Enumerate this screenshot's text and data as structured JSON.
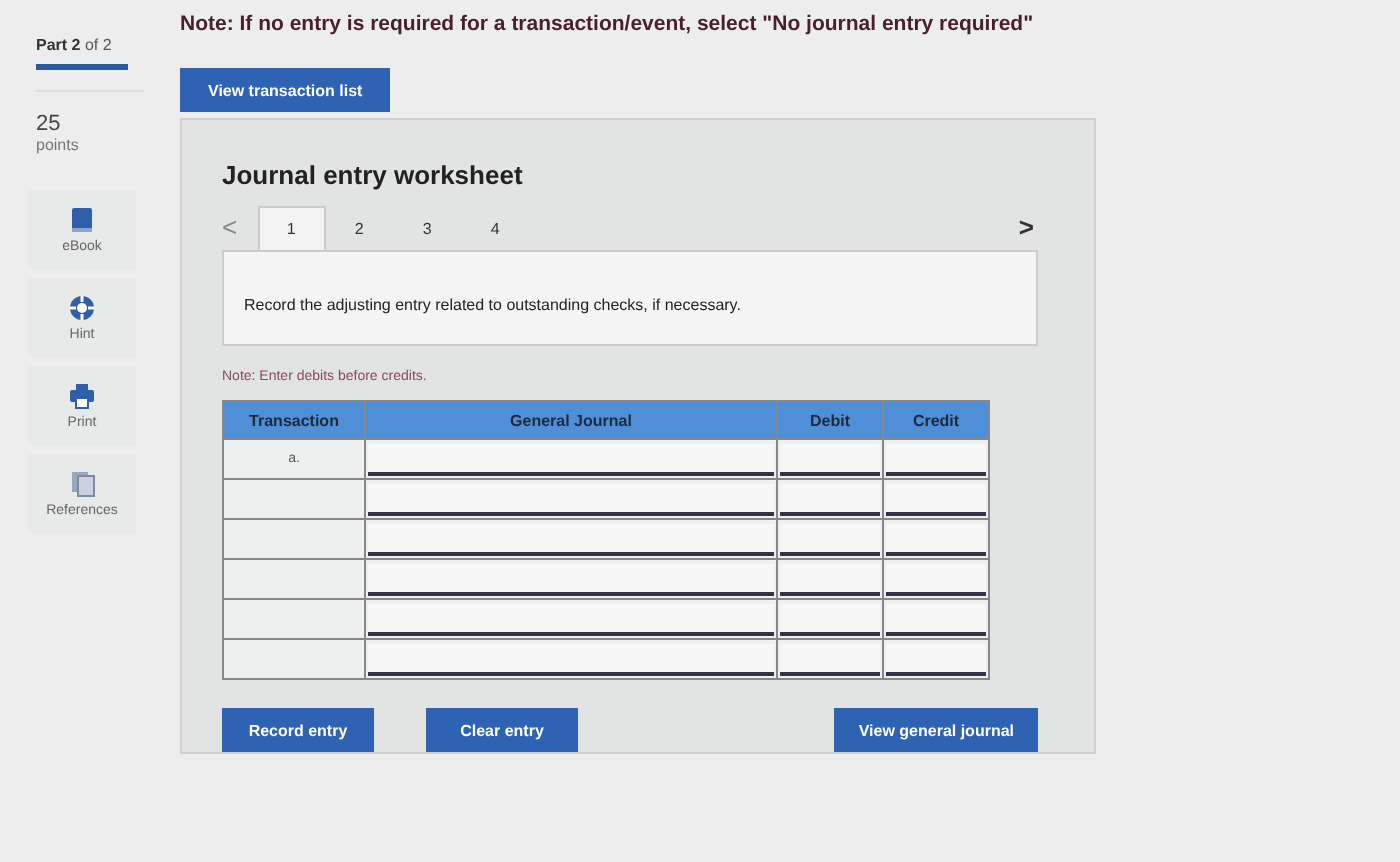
{
  "sidebar": {
    "part": {
      "label": "Part",
      "current": "2",
      "of": "of 2",
      "level": 1
    },
    "points": {
      "value": "25",
      "label": "points"
    },
    "items": [
      {
        "label": "eBook",
        "kind": "book"
      },
      {
        "label": "Hint",
        "kind": "hint"
      },
      {
        "label": "Print",
        "kind": "print"
      },
      {
        "label": "References",
        "kind": "references"
      }
    ]
  },
  "note": "Note: If no entry is required for a transaction/event, select \"No journal entry required\"",
  "view_transaction_button": "View transaction list",
  "worksheet": {
    "title": "Journal entry worksheet",
    "prev": "<",
    "next": ">",
    "tabs": [
      {
        "label": "1",
        "selected": true
      },
      {
        "label": "2",
        "selected": false
      },
      {
        "label": "3",
        "selected": false
      },
      {
        "label": "4",
        "selected": false
      }
    ],
    "instruction": "Record the adjusting entry related to outstanding checks, if necessary.",
    "debit_note": "Note: Enter debits before credits.",
    "columns": [
      "Transaction",
      "General Journal",
      "Debit",
      "Credit"
    ],
    "rows": [
      {
        "transaction": "a."
      },
      {
        "transaction": ""
      },
      {
        "transaction": ""
      },
      {
        "transaction": ""
      },
      {
        "transaction": ""
      },
      {
        "transaction": ""
      }
    ],
    "buttons": [
      "Record entry",
      "Clear entry",
      "View general journal"
    ]
  }
}
